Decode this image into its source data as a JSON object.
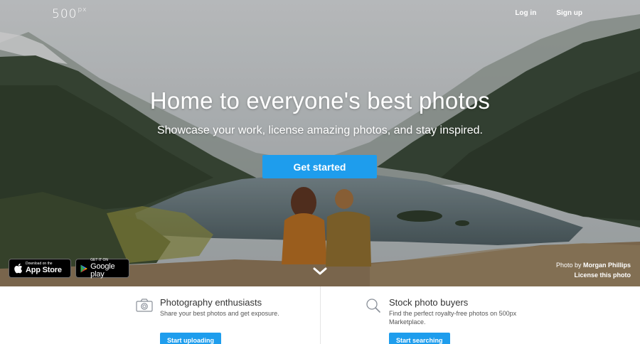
{
  "header": {
    "logo_text": "500",
    "logo_sup": "px",
    "login_label": "Log in",
    "signup_label": "Sign up"
  },
  "hero": {
    "headline": "Home to everyone's best photos",
    "subline": "Showcase your work, license amazing photos, and stay inspired.",
    "cta_label": "Get started",
    "app_store_small": "Download on the",
    "app_store_big": "App Store",
    "google_small": "GET IT ON",
    "google_big": "Google play",
    "credit_prefix": "Photo by",
    "credit_name": "Morgan Phillips",
    "license_label": "License this photo"
  },
  "features": [
    {
      "title": "Photography enthusiasts",
      "desc": "Share your best photos and get exposure.",
      "button": "Start uploading",
      "icon": "camera-icon"
    },
    {
      "title": "Stock photo buyers",
      "desc_line1": "Find the perfect royalty-free photos on 500px",
      "desc_line2": "Marketplace.",
      "button": "Start searching",
      "icon": "search-icon"
    }
  ],
  "colors": {
    "accent": "#1e9ded"
  }
}
